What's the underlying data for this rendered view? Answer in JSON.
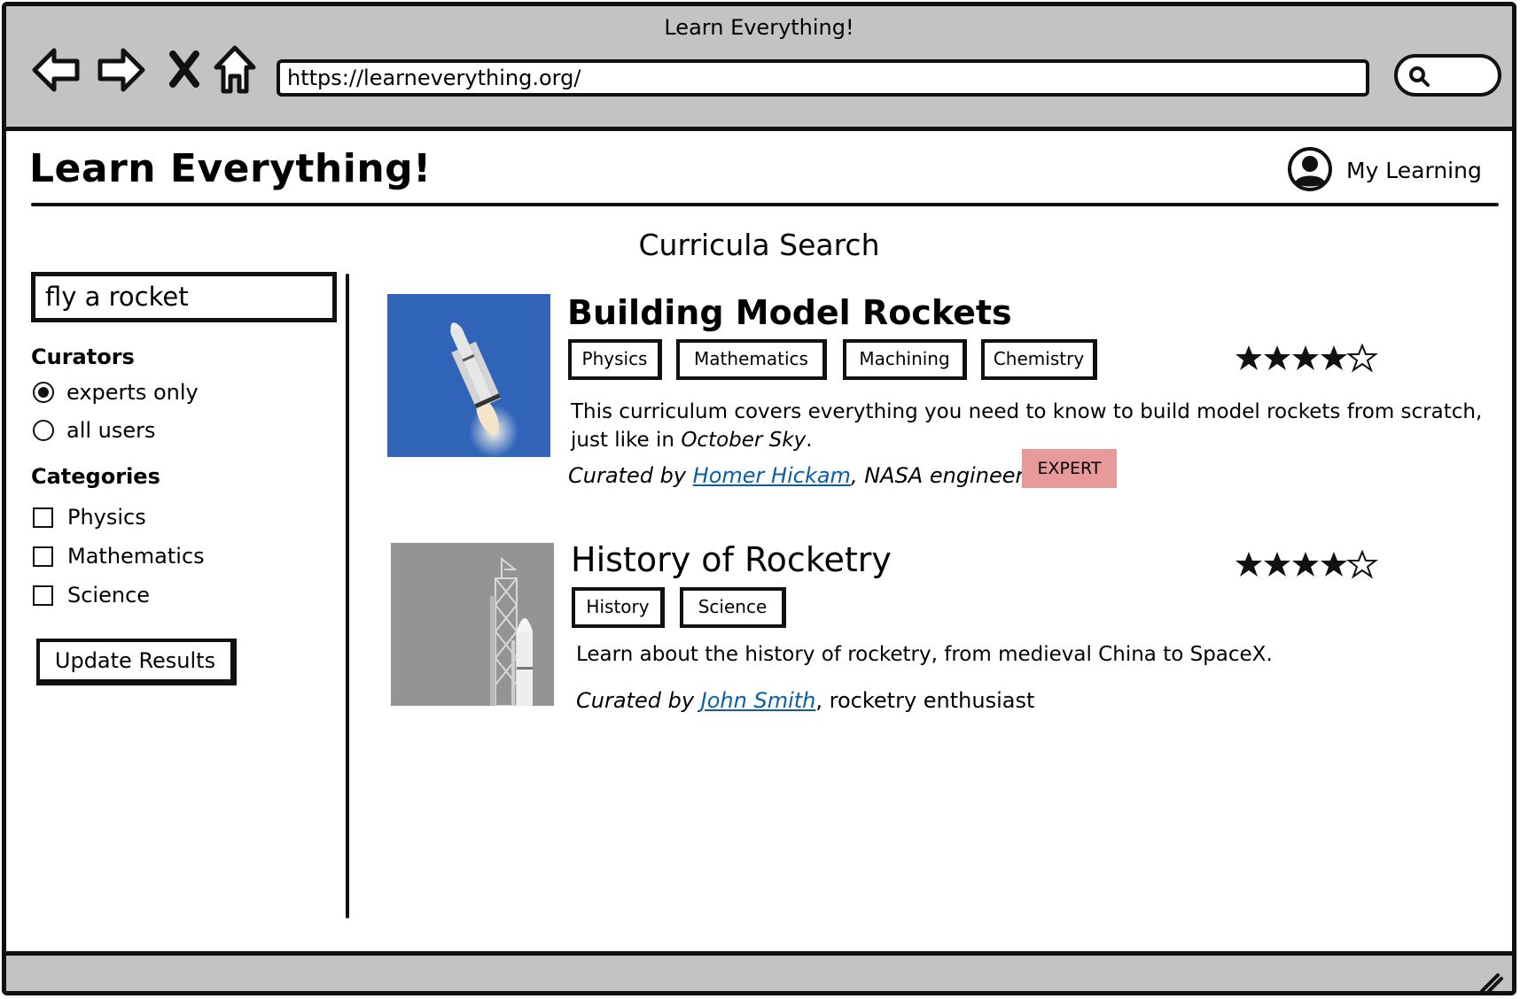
{
  "browser": {
    "window_title": "Learn Everything!",
    "url": "https://learneverything.org/"
  },
  "header": {
    "brand": "Learn Everything!",
    "account_label": "My Learning"
  },
  "page": {
    "heading": "Curricula Search"
  },
  "sidebar": {
    "query": "fly a rocket",
    "curators_label": "Curators",
    "curator_options": [
      {
        "label": "experts only",
        "selected": true
      },
      {
        "label": "all users",
        "selected": false
      }
    ],
    "categories_label": "Categories",
    "category_options": [
      {
        "label": "Physics",
        "checked": false
      },
      {
        "label": "Mathematics",
        "checked": false
      },
      {
        "label": "Science",
        "checked": false
      }
    ],
    "update_button": "Update Results"
  },
  "results": [
    {
      "title": "Building Model Rockets",
      "tags": [
        "Physics",
        "Mathematics",
        "Machining",
        "Chemistry"
      ],
      "rating": 4,
      "rating_max": 5,
      "description_text": "This curriculum covers everything you need to know to build model rockets from scratch, just like in",
      "description_italic": "October Sky",
      "description_end": ".",
      "curated_by_prefix": "Curated by",
      "curator_name": "Homer Hickam",
      "curator_role": ", NASA engineer",
      "badge": "EXPERT"
    },
    {
      "title": "History of Rocketry",
      "tags": [
        "History",
        "Science"
      ],
      "rating": 4.5,
      "rating_max": 5,
      "description_text": "Learn about the history of rocketry, from medieval China to SpaceX.",
      "curated_by_prefix": "Curated by",
      "curator_name": "John Smith",
      "curator_role": ", rocketry enthusiast"
    }
  ],
  "colors": {
    "chrome": "#c3c3c3",
    "link": "#0a5ea8",
    "expert_badge": "#e89a9a",
    "thumb_sky": "#2f64b8"
  }
}
